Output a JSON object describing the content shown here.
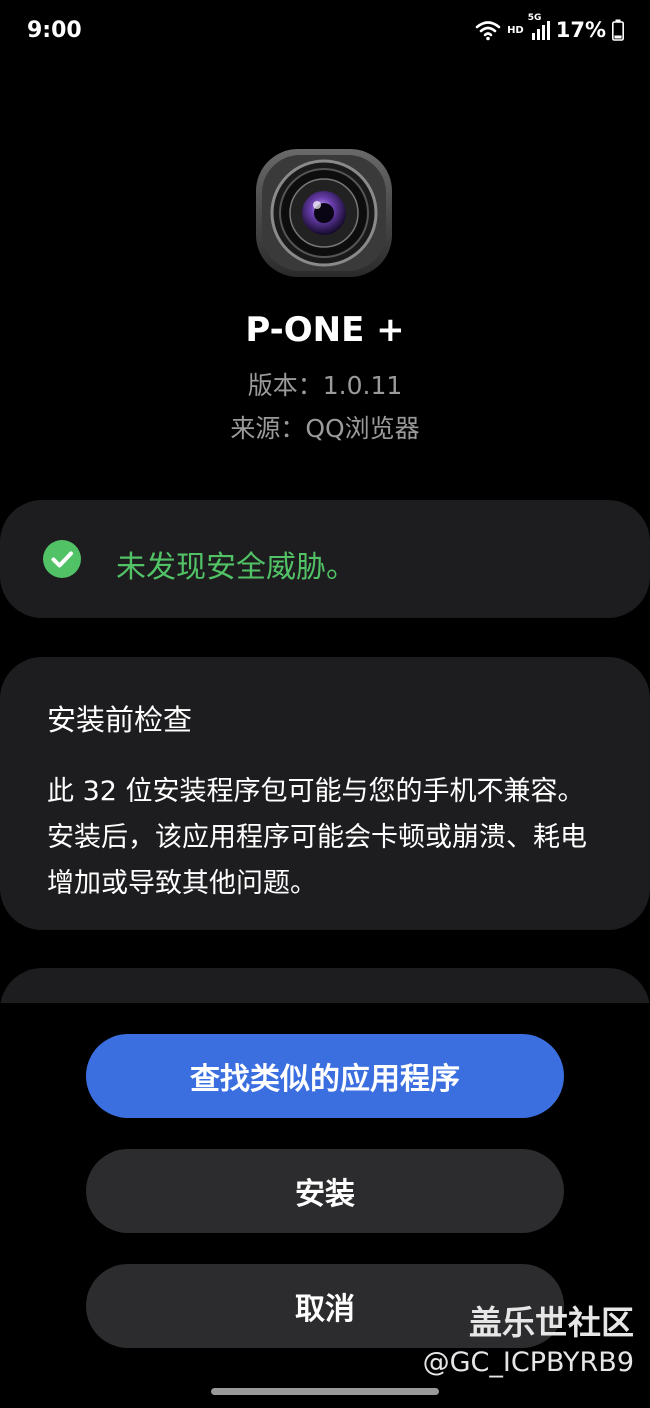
{
  "status_bar": {
    "time": "9:00",
    "hd_label": "HD",
    "network_label": "5G",
    "battery_text": "17%",
    "icons": [
      "wifi-icon",
      "signal-icon",
      "battery-icon"
    ]
  },
  "app": {
    "name": "P-ONE +",
    "version": "版本：1.0.11",
    "source": "来源：QQ浏览器",
    "icon": "camera-lens-icon"
  },
  "security": {
    "message": "未发现安全威胁。",
    "icon": "check-circle-icon",
    "color": "#52c266"
  },
  "precheck": {
    "title": "安装前检查",
    "body": "此 32 位安装程序包可能与您的手机不兼容。安装后，该应用程序可能会卡顿或崩溃、耗电增加或导致其他问题。"
  },
  "buttons": {
    "find_similar": "查找类似的应用程序",
    "install": "安装",
    "cancel": "取消"
  },
  "watermark": {
    "title": "盖乐世社区",
    "id": "@GC_ICPBYRB9"
  },
  "colors": {
    "background": "#000000",
    "card": "#1d1d1f",
    "primary_button": "#3b6fe0",
    "secondary_button": "#2c2c2e"
  }
}
